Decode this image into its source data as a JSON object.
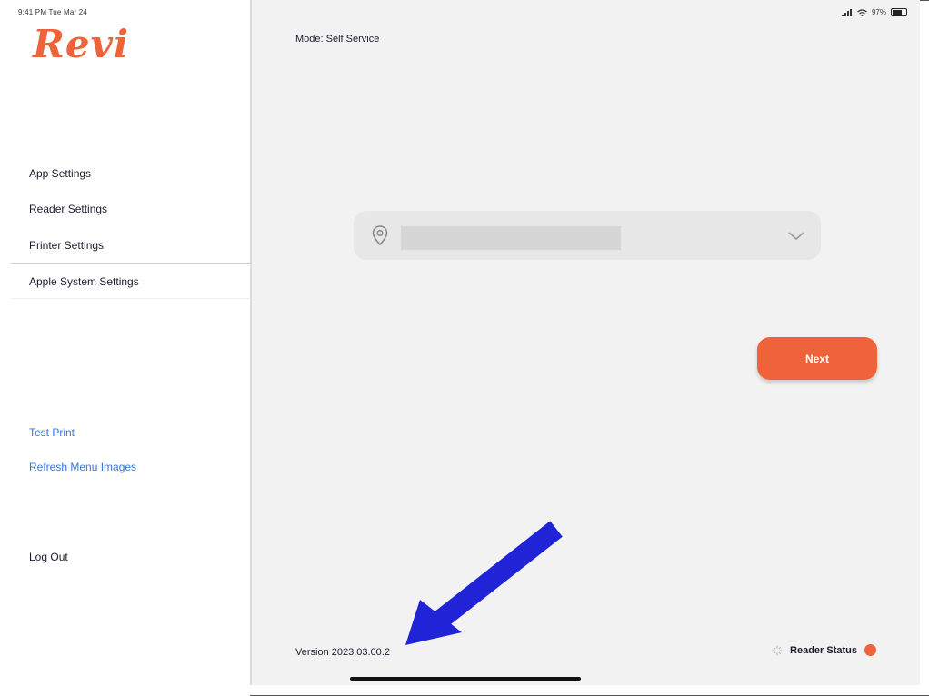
{
  "status_bar": {
    "left_text": "9:41 PM  Tue Mar 24",
    "right_text": "97%"
  },
  "sidebar": {
    "logo_text": "Revi",
    "items": [
      {
        "label": "App Settings"
      },
      {
        "label": "Reader Settings"
      },
      {
        "label": "Printer Settings"
      },
      {
        "label": "Apple System Settings"
      }
    ],
    "links": [
      {
        "label": "Test Print"
      },
      {
        "label": "Refresh Menu Images"
      }
    ],
    "logout_label": "Log Out"
  },
  "main": {
    "mode_title": "Mode: Self Service",
    "next_label": "Next",
    "version": "Version 2023.03.00.2",
    "reader_status_label": "Reader Status"
  },
  "colors": {
    "accent": "#ee6339",
    "link": "#3a75d8",
    "annotation_arrow": "#2024d6"
  },
  "icons": {
    "location": "map-pin-icon",
    "dropdown": "chevron-down-icon",
    "spinner": "loading-spinner-icon",
    "battery": "battery-icon",
    "wifi": "wifi-icon",
    "signal": "signal-icon"
  }
}
